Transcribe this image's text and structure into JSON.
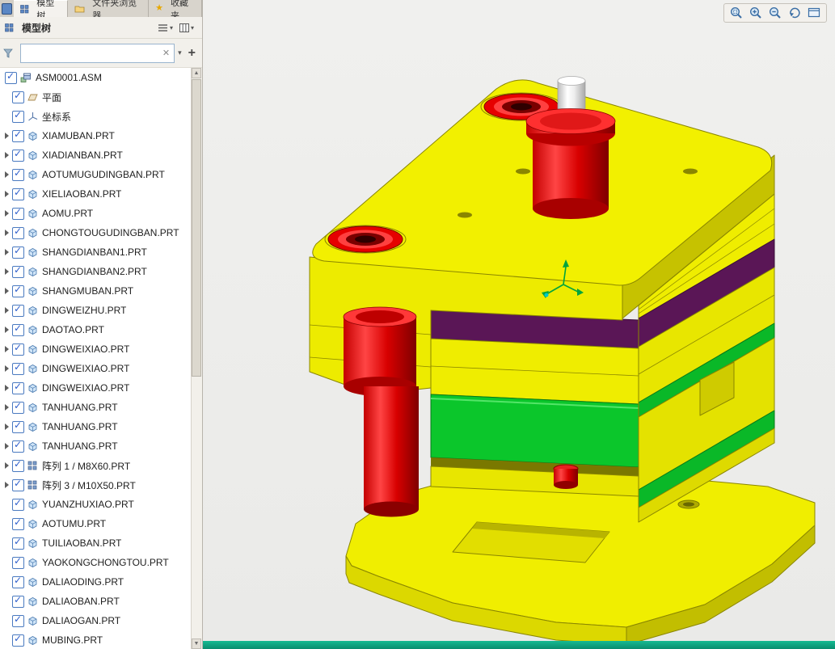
{
  "tabs": [
    {
      "label": "模型树"
    },
    {
      "label": "文件夹浏览器"
    },
    {
      "label": "收藏夹"
    }
  ],
  "panel": {
    "title": "模型树",
    "search_value": ""
  },
  "tree": {
    "root": {
      "label": "ASM0001.ASM",
      "checked": true
    },
    "items": [
      {
        "label": "平面",
        "icon": "plane",
        "arrow": false,
        "checked": true
      },
      {
        "label": "坐标系",
        "icon": "csys",
        "arrow": false,
        "checked": true
      },
      {
        "label": "XIAMUBAN.PRT",
        "icon": "part",
        "arrow": true,
        "checked": true
      },
      {
        "label": "XIADIANBAN.PRT",
        "icon": "part",
        "arrow": true,
        "checked": true
      },
      {
        "label": "AOTUMUGUDINGBAN.PRT",
        "icon": "part",
        "arrow": true,
        "checked": true
      },
      {
        "label": "XIELIAOBAN.PRT",
        "icon": "part",
        "arrow": true,
        "checked": true
      },
      {
        "label": "AOMU.PRT",
        "icon": "part",
        "arrow": true,
        "checked": true
      },
      {
        "label": "CHONGTOUGUDINGBAN.PRT",
        "icon": "part",
        "arrow": true,
        "checked": true
      },
      {
        "label": "SHANGDIANBAN1.PRT",
        "icon": "part",
        "arrow": true,
        "checked": true
      },
      {
        "label": "SHANGDIANBAN2.PRT",
        "icon": "part",
        "arrow": true,
        "checked": true
      },
      {
        "label": "SHANGMUBAN.PRT",
        "icon": "part",
        "arrow": true,
        "checked": true
      },
      {
        "label": "DINGWEIZHU.PRT",
        "icon": "part",
        "arrow": true,
        "checked": true
      },
      {
        "label": "DAOTAO.PRT",
        "icon": "part",
        "arrow": true,
        "checked": true
      },
      {
        "label": "DINGWEIXIAO.PRT",
        "icon": "part",
        "arrow": true,
        "checked": true
      },
      {
        "label": "DINGWEIXIAO.PRT",
        "icon": "part",
        "arrow": true,
        "checked": true
      },
      {
        "label": "DINGWEIXIAO.PRT",
        "icon": "part",
        "arrow": true,
        "checked": true
      },
      {
        "label": "TANHUANG.PRT",
        "icon": "part",
        "arrow": true,
        "checked": true
      },
      {
        "label": "TANHUANG.PRT",
        "icon": "part",
        "arrow": true,
        "checked": true
      },
      {
        "label": "TANHUANG.PRT",
        "icon": "part",
        "arrow": true,
        "checked": true
      },
      {
        "label": "阵列 1 / M8X60.PRT",
        "icon": "pattern",
        "arrow": true,
        "checked": true
      },
      {
        "label": "阵列 3 / M10X50.PRT",
        "icon": "pattern",
        "arrow": true,
        "checked": true
      },
      {
        "label": "YUANZHUXIAO.PRT",
        "icon": "part",
        "arrow": false,
        "checked": true
      },
      {
        "label": "AOTUMU.PRT",
        "icon": "part",
        "arrow": false,
        "checked": true
      },
      {
        "label": "TUILIAOBAN.PRT",
        "icon": "part",
        "arrow": false,
        "checked": true
      },
      {
        "label": "YAOKONGCHONGTOU.PRT",
        "icon": "part",
        "arrow": false,
        "checked": true
      },
      {
        "label": "DALIAODING.PRT",
        "icon": "part",
        "arrow": false,
        "checked": true
      },
      {
        "label": "DALIAOBAN.PRT",
        "icon": "part",
        "arrow": false,
        "checked": true
      },
      {
        "label": "DALIAOGAN.PRT",
        "icon": "part",
        "arrow": false,
        "checked": true
      },
      {
        "label": "MUBING.PRT",
        "icon": "part",
        "arrow": false,
        "checked": true
      }
    ]
  },
  "viewer": {
    "toolbar": [
      {
        "name": "zoom-region"
      },
      {
        "name": "zoom-in"
      },
      {
        "name": "zoom-out"
      },
      {
        "name": "spin-center"
      },
      {
        "name": "view-manager"
      }
    ]
  },
  "colors": {
    "part_yellow": "#F2F000",
    "part_yellow_shade": "#C6C200",
    "part_red": "#E80000",
    "part_green": "#0BC62B",
    "part_purple": "#5A1656",
    "viewport_bg": "#EDEDEB",
    "statusbar_green": "#0EA987"
  }
}
